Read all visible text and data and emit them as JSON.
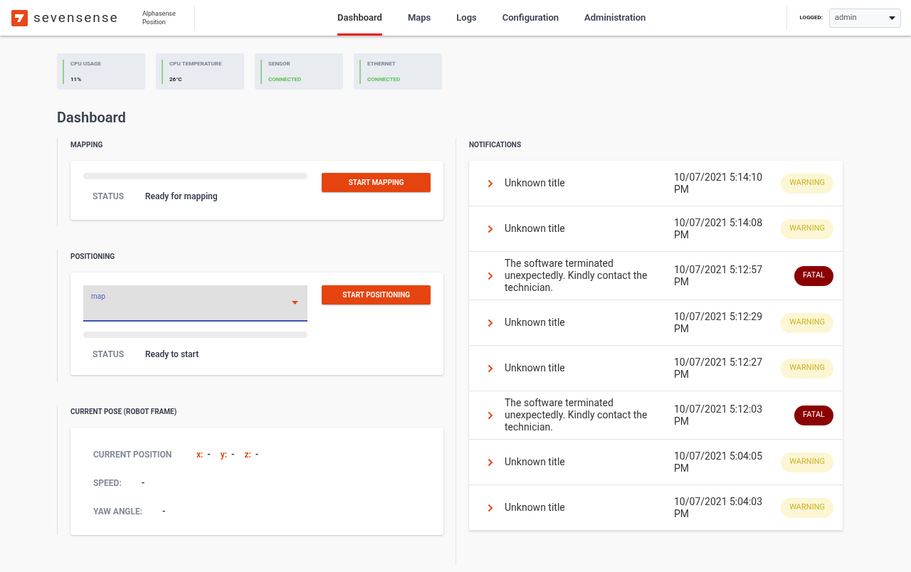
{
  "header": {
    "brand": "sevensense",
    "product": [
      "Alphasense",
      "Position"
    ],
    "tabs": [
      {
        "label": "Dashboard",
        "selected": true
      },
      {
        "label": "Maps",
        "selected": false
      },
      {
        "label": "Logs",
        "selected": false
      },
      {
        "label": "Configuration",
        "selected": false
      },
      {
        "label": "Administration",
        "selected": false
      }
    ],
    "logged_label": "LOGGED:",
    "user": "admin"
  },
  "stats": [
    {
      "label": "CPU USAGE",
      "value": "11%",
      "kind": "plain"
    },
    {
      "label": "CPU TEMPERATURE",
      "value": "26°C",
      "kind": "plain"
    },
    {
      "label": "SENSOR",
      "value": "CONNECTED",
      "kind": "ok"
    },
    {
      "label": "ETHERNET",
      "value": "CONNECTED",
      "kind": "ok"
    }
  ],
  "title": "Dashboard",
  "mapping": {
    "heading": "MAPPING",
    "level": 0,
    "status_label": "STATUS",
    "status": "Ready for mapping",
    "button": "START MAPPING"
  },
  "positioning": {
    "heading": "POSITIONING",
    "select_label": "map",
    "level": 0,
    "status_label": "STATUS",
    "status": "Ready to start",
    "button": "START POSITIONING"
  },
  "pose": {
    "heading": "CURRENT POSE (ROBOT FRAME)",
    "position_label": "CURRENT POSITION",
    "coords": [
      {
        "axis": "x:",
        "value": "-"
      },
      {
        "axis": "y:",
        "value": "-"
      },
      {
        "axis": "z:",
        "value": "-"
      }
    ],
    "rows": [
      {
        "label": "SPEED:",
        "value": "-"
      },
      {
        "label": "YAW ANGLE:",
        "value": "-"
      }
    ]
  },
  "notifications": {
    "heading": "NOTIFICATIONS",
    "items": [
      {
        "title": "Unknown title",
        "time": "10/07/2021 5:14:10 PM",
        "level": "WARNING",
        "kind": "warning"
      },
      {
        "title": "Unknown title",
        "time": "10/07/2021 5:14:08 PM",
        "level": "WARNING",
        "kind": "warning"
      },
      {
        "title": "The software terminated unexpectedly. Kindly contact the technician.",
        "time": "10/07/2021 5:12:57 PM",
        "level": "FATAL",
        "kind": "fatal"
      },
      {
        "title": "Unknown title",
        "time": "10/07/2021 5:12:29 PM",
        "level": "WARNING",
        "kind": "warning"
      },
      {
        "title": "Unknown title",
        "time": "10/07/2021 5:12:27 PM",
        "level": "WARNING",
        "kind": "warning"
      },
      {
        "title": "The software terminated unexpectedly. Kindly contact the technician.",
        "time": "10/07/2021 5:12:03 PM",
        "level": "FATAL",
        "kind": "fatal"
      },
      {
        "title": "Unknown title",
        "time": "10/07/2021 5:04:05 PM",
        "level": "WARNING",
        "kind": "warning"
      },
      {
        "title": "Unknown title",
        "time": "10/07/2021 5:04:03 PM",
        "level": "WARNING",
        "kind": "warning"
      }
    ]
  }
}
